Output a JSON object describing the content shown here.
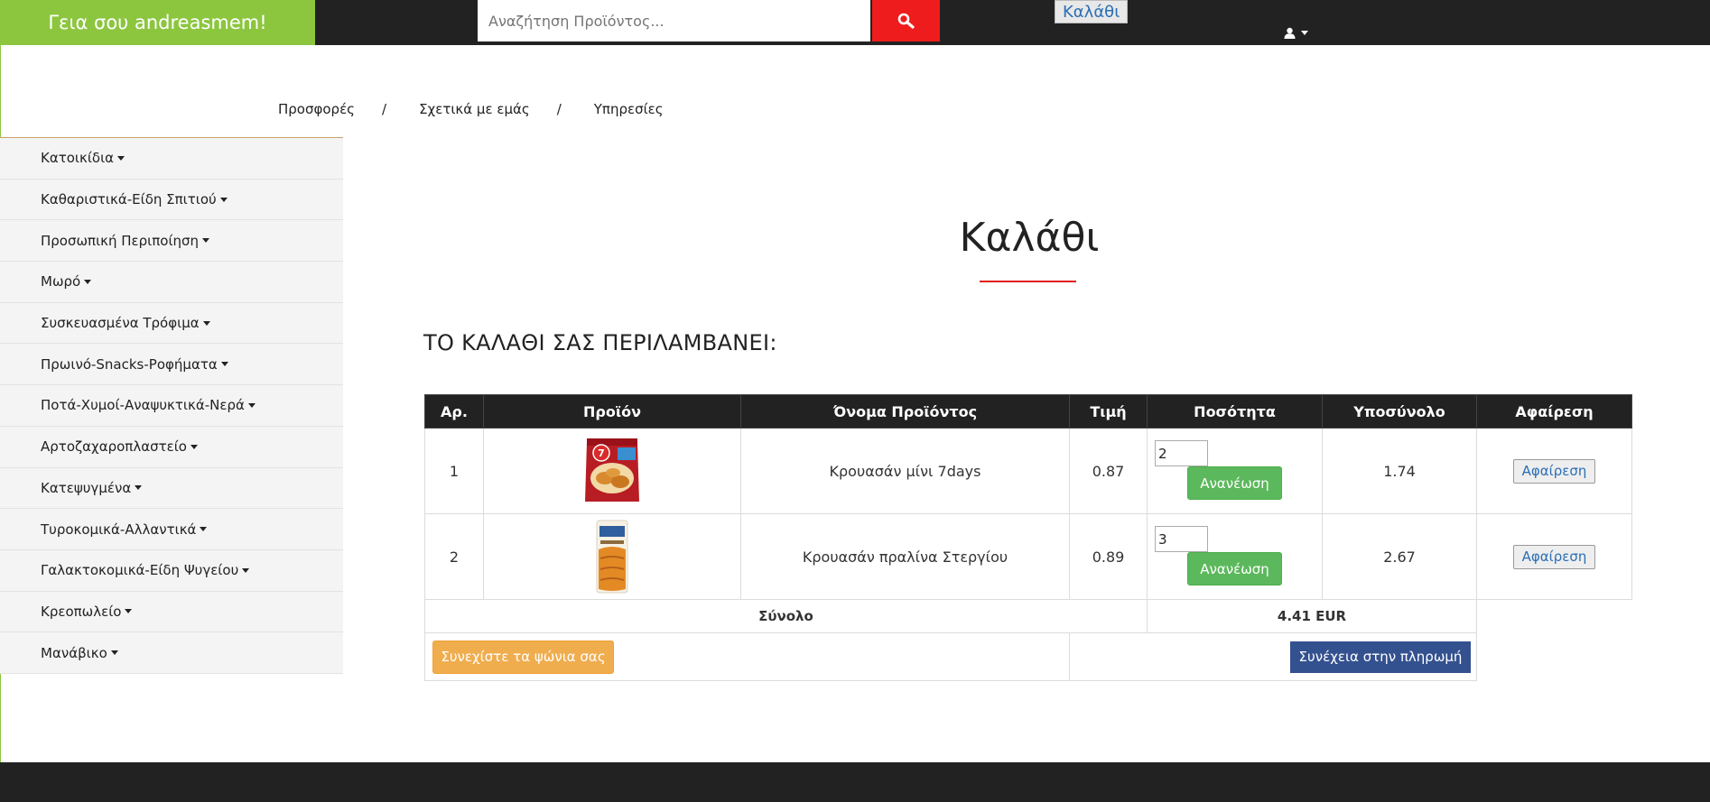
{
  "header": {
    "greeting": "Γεια σου andreasmem!",
    "search_placeholder": "Αναζήτηση Προϊόντος...",
    "cart_link": "Καλάθι"
  },
  "topnav": {
    "items": [
      "Προσφορές",
      "Σχετικά με εμάς",
      "Υπηρεσίες"
    ],
    "separator": "/"
  },
  "sidebar": {
    "categories": [
      "Κατοικίδια",
      "Καθαριστικά-Είδη Σπιτιού",
      "Προσωπική Περιποίηση",
      "Μωρό",
      "Συσκευασμένα Τρόφιμα",
      "Πρωινό-Snacks-Ροφήματα",
      "Ποτά-Χυμοί-Αναψυκτικά-Νερά",
      "Αρτοζαχαροπλαστείο",
      "Κατεψυγμένα",
      "Τυροκομικά-Αλλαντικά",
      "Γαλακτοκομικά-Είδη Ψυγείου",
      "Κρεοπωλείο",
      "Μανάβικο"
    ]
  },
  "main": {
    "title": "Καλάθι",
    "subheading": "ΤΟ ΚΑΛΑΘΙ ΣΑΣ ΠΕΡΙΛΑΜΒΑΝΕΙ:",
    "table": {
      "headers": [
        "Αρ.",
        "Προϊόν",
        "Όνομα Προϊόντος",
        "Τιμή",
        "Ποσότητα",
        "Υποσύνολο",
        "Αφαίρεση"
      ],
      "rows": [
        {
          "no": "1",
          "name": "Κρουασάν μίνι 7days",
          "price": "0.87",
          "qty": "2",
          "subtotal": "1.74"
        },
        {
          "no": "2",
          "name": "Κρουασάν πραλίνα Στεργίου",
          "price": "0.89",
          "qty": "3",
          "subtotal": "2.67"
        }
      ],
      "update_label": "Ανανέωση",
      "remove_label": "Αφαίρεση",
      "total_label": "Σύνολο",
      "total_value": "4.41 EUR"
    },
    "continue_label": "Συνεχίστε τα ψώνια σας",
    "checkout_label": "Συνέχεια στην πληρωμή"
  },
  "colors": {
    "topbar": "#222222",
    "greeting_bg": "#8cc63f",
    "search_button": "#ee1c1c",
    "update_button": "#5cb85c",
    "continue_button": "#f0ad4e",
    "checkout_button": "#34518f",
    "total_text": "#e21b1b"
  },
  "icons": {
    "search": "search-icon",
    "user": "user-icon",
    "caret": "caret-down-icon"
  }
}
